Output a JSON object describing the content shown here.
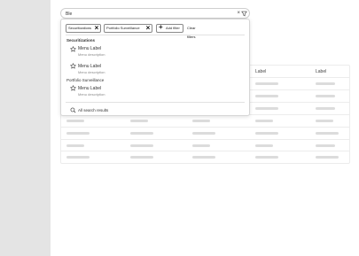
{
  "search": {
    "value": "Ble"
  },
  "filters": {
    "chips": [
      "Securitizations",
      "Portfolio Surveillance"
    ],
    "add_filter_label": "Add filter",
    "clear_filters_label": "Clear filters"
  },
  "sections": [
    {
      "title": "Securitizations",
      "items": [
        {
          "label": "Menu Label",
          "description": "Menu description"
        },
        {
          "label": "Menu Label",
          "description": "Menu description"
        }
      ]
    },
    {
      "title": "Portfolio Surveillance",
      "items": [
        {
          "label": "Menu Label",
          "description": "Menu description"
        }
      ]
    }
  ],
  "all_results_label": "All search results",
  "table": {
    "headers": [
      "Label",
      "Label"
    ]
  }
}
